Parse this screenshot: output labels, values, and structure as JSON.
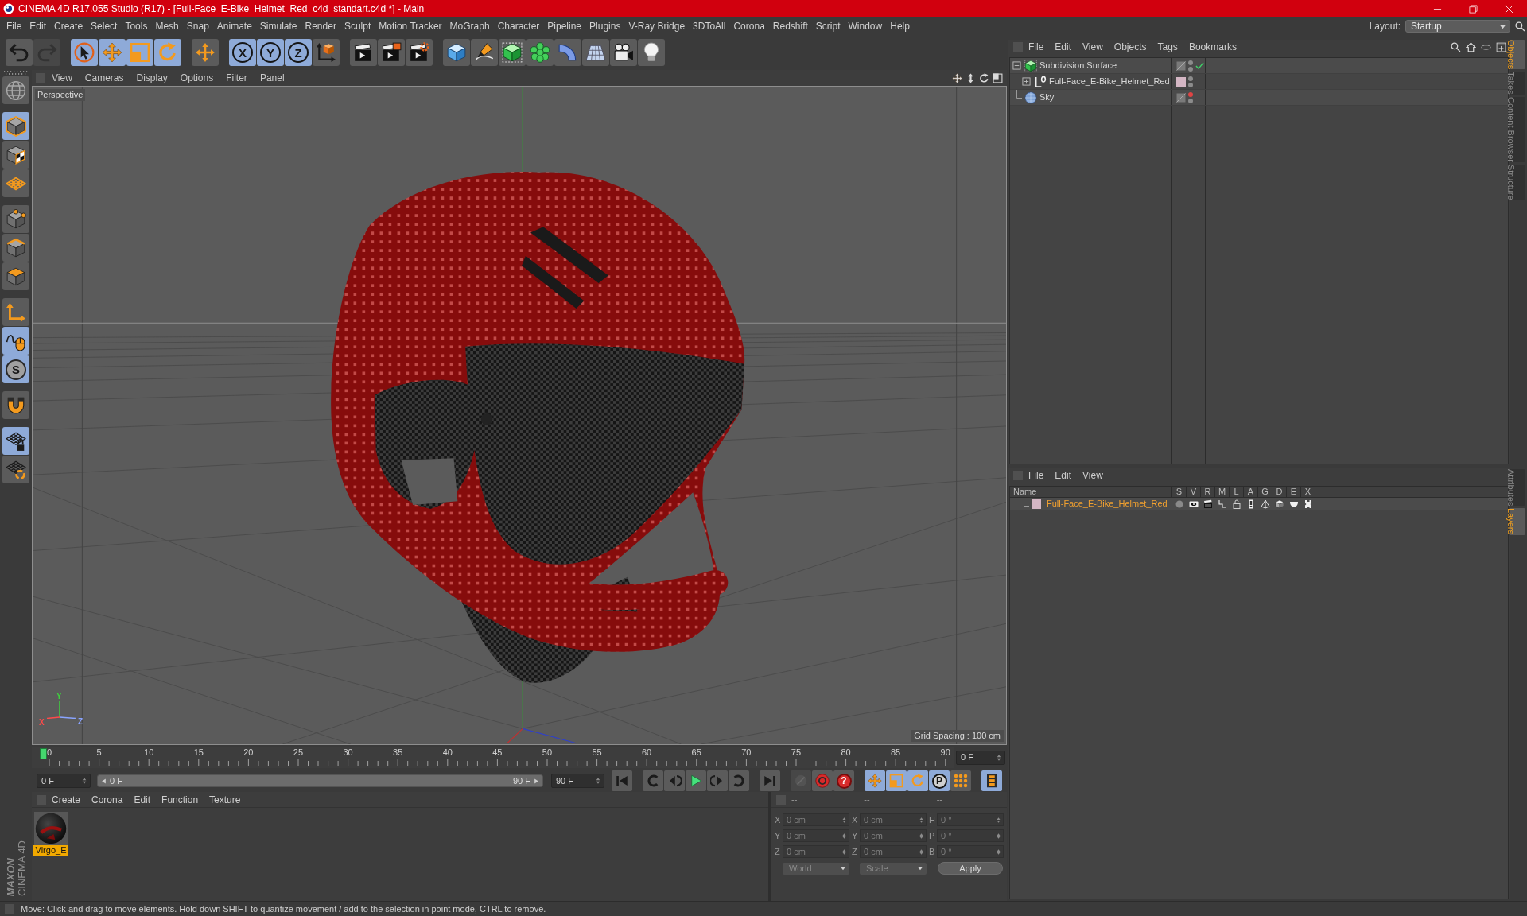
{
  "window": {
    "title": "CINEMA 4D R17.055 Studio (R17) - [Full-Face_E-Bike_Helmet_Red_c4d_standart.c4d *] - Main"
  },
  "menu_bar": [
    "File",
    "Edit",
    "Create",
    "Select",
    "Tools",
    "Mesh",
    "Snap",
    "Animate",
    "Simulate",
    "Render",
    "Sculpt",
    "Motion Tracker",
    "MoGraph",
    "Character",
    "Pipeline",
    "Plugins",
    "V-Ray Bridge",
    "3DToAll",
    "Corona",
    "Redshift",
    "Script",
    "Window",
    "Help"
  ],
  "layout": {
    "label": "Layout:",
    "value": "Startup"
  },
  "toolbar": [
    {
      "buttons": [
        {
          "kind": "undo",
          "active": false,
          "disabled": false
        },
        {
          "kind": "redo",
          "active": false,
          "disabled": true
        }
      ]
    },
    {
      "buttons": [
        {
          "kind": "select",
          "active": true,
          "disabled": false
        },
        {
          "kind": "move",
          "active": true,
          "disabled": false
        },
        {
          "kind": "scale",
          "active": true,
          "disabled": false
        },
        {
          "kind": "rotate",
          "active": true,
          "disabled": false
        }
      ]
    },
    {
      "buttons": [
        {
          "kind": "last-tool",
          "active": false,
          "disabled": false
        }
      ]
    },
    {
      "buttons": [
        {
          "kind": "axis",
          "label": "X",
          "active": true,
          "disabled": false
        },
        {
          "kind": "axis",
          "label": "Y",
          "active": true,
          "disabled": false
        },
        {
          "kind": "axis",
          "label": "Z",
          "active": true,
          "disabled": false
        },
        {
          "kind": "coordinate-system",
          "active": false,
          "disabled": false
        }
      ]
    },
    {
      "buttons": [
        {
          "kind": "render-view",
          "active": false,
          "disabled": false
        },
        {
          "kind": "render-picture",
          "active": false,
          "disabled": false
        },
        {
          "kind": "render-settings",
          "active": false,
          "disabled": false
        }
      ]
    },
    {
      "buttons": [
        {
          "kind": "cube",
          "active": false,
          "disabled": false
        },
        {
          "kind": "pen",
          "active": false,
          "disabled": false
        },
        {
          "kind": "subdivision",
          "active": false,
          "disabled": false
        },
        {
          "kind": "cloner",
          "active": false,
          "disabled": false
        },
        {
          "kind": "deformer",
          "active": false,
          "disabled": false
        },
        {
          "kind": "floor",
          "active": false,
          "disabled": false
        },
        {
          "kind": "camera",
          "active": false,
          "disabled": false
        },
        {
          "kind": "light",
          "active": false,
          "disabled": false
        }
      ]
    }
  ],
  "left_toolbar": [
    {
      "buttons": [
        {
          "kind": "make-editable",
          "active": false,
          "disabled": false
        }
      ]
    },
    {
      "buttons": [
        {
          "kind": "model",
          "active": true,
          "disabled": false
        },
        {
          "kind": "texture",
          "active": false,
          "disabled": false
        },
        {
          "kind": "workplane",
          "active": false,
          "disabled": false
        }
      ]
    },
    {
      "buttons": [
        {
          "kind": "points",
          "active": false,
          "disabled": false
        },
        {
          "kind": "edges",
          "active": false,
          "disabled": false
        },
        {
          "kind": "polygons",
          "active": false,
          "disabled": false
        }
      ]
    },
    {
      "buttons": [
        {
          "kind": "axis-mode",
          "active": false,
          "disabled": false
        },
        {
          "kind": "tweak",
          "active": true,
          "disabled": false
        },
        {
          "kind": "solo",
          "label": "S",
          "active": true,
          "disabled": false
        }
      ]
    },
    {
      "buttons": [
        {
          "kind": "snap",
          "active": false,
          "disabled": false
        }
      ]
    },
    {
      "buttons": [
        {
          "kind": "workplane-lock",
          "active": true,
          "disabled": false
        },
        {
          "kind": "workplane-rotate",
          "active": false,
          "disabled": false
        }
      ]
    }
  ],
  "viewport": {
    "menus": [
      "View",
      "Cameras",
      "Display",
      "Options",
      "Filter",
      "Panel"
    ],
    "camera": "Perspective",
    "grid_spacing": "Grid Spacing : 100 cm",
    "axes": [
      {
        "label": "Y",
        "color": "#3fd03f"
      },
      {
        "label": "X",
        "color": "#ff4a4a"
      },
      {
        "label": "Z",
        "color": "#8aa4ff"
      }
    ]
  },
  "timeline": {
    "ticks": [
      "0",
      "5",
      "10",
      "15",
      "20",
      "25",
      "30",
      "35",
      "40",
      "45",
      "50",
      "55",
      "60",
      "65",
      "70",
      "75",
      "80",
      "85",
      "90"
    ],
    "playhead": {
      "level": 0
    },
    "current_frame": "0 F",
    "start_field": "0 F",
    "range": {
      "start": "0 F",
      "end": "90 F",
      "level": 1
    },
    "end_field": "90 F"
  },
  "transport": [
    {
      "buttons": [
        {
          "kind": "go-start",
          "active": false,
          "disabled": false
        }
      ]
    },
    {
      "buttons": [
        {
          "kind": "prev-key",
          "active": false,
          "disabled": false
        },
        {
          "kind": "prev-frame",
          "active": false,
          "disabled": false
        },
        {
          "kind": "play",
          "active": false,
          "disabled": false
        },
        {
          "kind": "next-frame",
          "active": false,
          "disabled": false
        },
        {
          "kind": "next-key",
          "active": false,
          "disabled": false
        }
      ]
    },
    {
      "buttons": [
        {
          "kind": "go-end",
          "active": false,
          "disabled": false
        }
      ]
    },
    {
      "buttons": [
        {
          "kind": "record",
          "active": false,
          "disabled": true
        },
        {
          "kind": "autokey",
          "active": false,
          "disabled": false
        },
        {
          "kind": "key-selection",
          "label": "?",
          "active": false,
          "disabled": false
        }
      ]
    },
    {
      "buttons": [
        {
          "kind": "position-key",
          "active": true,
          "disabled": false
        },
        {
          "kind": "scale-key",
          "active": true,
          "disabled": false
        },
        {
          "kind": "rotation-key",
          "active": true,
          "disabled": false
        },
        {
          "kind": "param",
          "label": "P",
          "active": true,
          "disabled": false
        },
        {
          "kind": "point-level",
          "active": false,
          "disabled": false
        }
      ]
    },
    {
      "buttons": [
        {
          "kind": "timeline",
          "active": true,
          "disabled": false
        }
      ]
    }
  ],
  "materials_panel": {
    "menus": [
      "Create",
      "Corona",
      "Edit",
      "Function",
      "Texture"
    ],
    "materials": [
      {
        "name": "Virgo_E",
        "selected": true
      }
    ]
  },
  "coordinates_panel": {
    "headers": [
      "--",
      "--",
      "--"
    ],
    "rows": [
      {
        "position_axis": "X",
        "position": "0 cm",
        "size_axis": "X",
        "size": "0 cm",
        "rotation_axis": "H",
        "rotation": "0 °"
      },
      {
        "position_axis": "Y",
        "position": "0 cm",
        "size_axis": "Y",
        "size": "0 cm",
        "rotation_axis": "P",
        "rotation": "0 °"
      },
      {
        "position_axis": "Z",
        "position": "0 cm",
        "size_axis": "Z",
        "size": "0 cm",
        "rotation_axis": "B",
        "rotation": "0 °"
      }
    ],
    "mode": "World",
    "size_mode": "Scale",
    "apply": "Apply"
  },
  "logo": {
    "brand": "MAXON",
    "product": "CINEMA 4D"
  },
  "objects_panel": {
    "menus": [
      "File",
      "Edit",
      "View",
      "Objects",
      "Tags",
      "Bookmarks"
    ],
    "objects": [
      {
        "name": "Subdivision Surface",
        "kind": "subdivision",
        "expanded": true,
        "enabled": true,
        "hidden_in_editor": false,
        "children": [
          {
            "name": "Full-Face_E-Bike_Helmet_Red",
            "kind": "null",
            "expanded": false,
            "color": "#d4b6c4",
            "hidden_in_editor": false
          }
        ]
      },
      {
        "name": "Sky",
        "kind": "sky",
        "hidden_in_editor": true
      }
    ]
  },
  "layers_panel": {
    "menus": [
      "File",
      "Edit",
      "View"
    ],
    "columns": [
      "Name",
      "S",
      "V",
      "R",
      "M",
      "L",
      "A",
      "G",
      "D",
      "E",
      "X"
    ],
    "layers": [
      {
        "name": "Full-Face_E-Bike_Helmet_Red",
        "color": "#d4b6c4",
        "selected": true,
        "solo": false,
        "visible": true,
        "render": true,
        "manager": true,
        "locked": false,
        "animation": true,
        "generators": true,
        "deformers": true,
        "expressions": true,
        "xrefs": true
      }
    ]
  },
  "right_tabs": {
    "top": [
      {
        "label": "Objects",
        "selected": true
      },
      {
        "label": "Takes",
        "selected": false
      },
      {
        "label": "Content Browser",
        "selected": false
      },
      {
        "label": "Structure",
        "selected": false
      }
    ],
    "bottom": [
      {
        "label": "Attributes",
        "selected": false
      },
      {
        "label": "Layers",
        "selected": true
      }
    ]
  },
  "status_bar": "Move: Click and drag to move elements. Hold down SHIFT to quantize movement / add to the selection in point mode, CTRL to remove."
}
